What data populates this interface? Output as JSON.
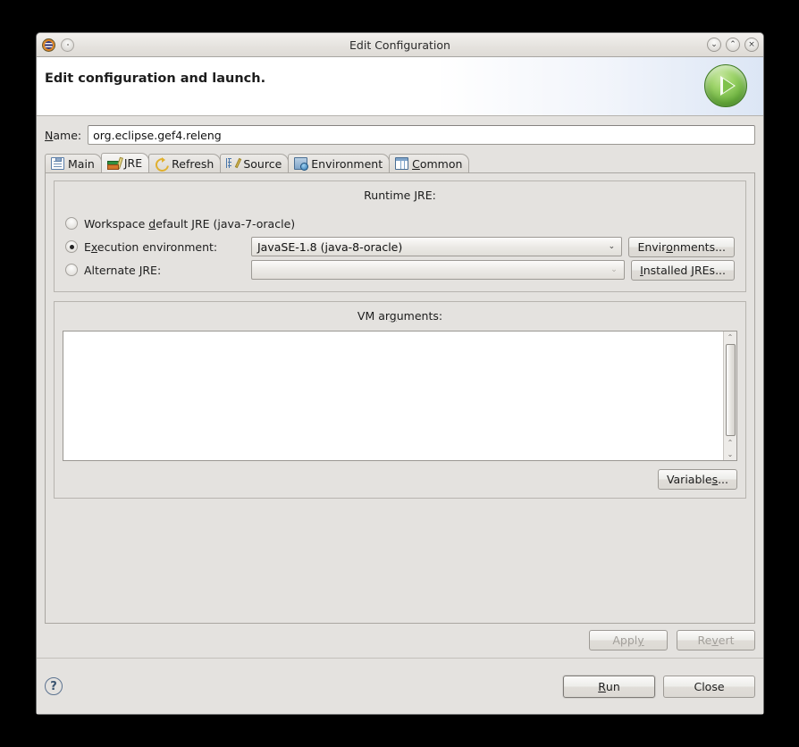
{
  "window": {
    "title": "Edit Configuration",
    "app_icon": "eclipse-icon",
    "menu_dot": "window-menu-icon",
    "controls": {
      "minimize": "⌄",
      "maximize": "⌃",
      "close": "×"
    }
  },
  "banner": {
    "title": "Edit configuration and launch.",
    "icon": "run-launch-icon"
  },
  "name_field": {
    "label": "Name:",
    "label_mnemonic": "N",
    "value": "org.eclipse.gef4.releng"
  },
  "tabs": [
    {
      "label": "Main",
      "icon": "main-document-icon",
      "active": false,
      "mnemonic": ""
    },
    {
      "label": "JRE",
      "icon": "jre-books-icon",
      "active": true,
      "mnemonic": ""
    },
    {
      "label": "Refresh",
      "icon": "refresh-arrows-icon",
      "active": false,
      "mnemonic": ""
    },
    {
      "label": "Source",
      "icon": "source-tree-icon",
      "active": false,
      "mnemonic": ""
    },
    {
      "label": "Environment",
      "icon": "environment-monitor-icon",
      "active": false,
      "mnemonic": ""
    },
    {
      "label": "Common",
      "icon": "common-table-icon",
      "active": false,
      "mnemonic": "C"
    }
  ],
  "runtime_jre": {
    "group_title": "Runtime JRE:",
    "options": [
      {
        "id": "workspace-default",
        "label_pre": "Workspace ",
        "label_mnemonic": "d",
        "label_post": "efault JRE (java-7-oracle)",
        "selected": false
      },
      {
        "id": "execution-environment",
        "label_pre": "E",
        "label_mnemonic": "x",
        "label_post": "ecution environment:",
        "selected": true,
        "combo_value": "JavaSE-1.8 (java-8-oracle)",
        "combo_disabled": false,
        "button_pre": "Envir",
        "button_mnemonic": "o",
        "button_post": "nments..."
      },
      {
        "id": "alternate-jre",
        "label_pre": "Alternate ",
        "label_mnemonic": "J",
        "label_post": "RE:",
        "selected": false,
        "combo_value": "",
        "combo_disabled": true,
        "button_pre": "",
        "button_mnemonic": "I",
        "button_post": "nstalled JREs..."
      }
    ],
    "combo_arrow": "⌄"
  },
  "vm_arguments": {
    "title_pre": "VM ar",
    "title_mnemonic": "g",
    "title_post": "uments:",
    "value": "",
    "variables_button": {
      "pre": "Variable",
      "mnemonic": "s",
      "post": "..."
    },
    "scrollbar": {
      "up": "⌃",
      "down": "⌄"
    }
  },
  "apply_revert": {
    "apply": {
      "pre": "Appl",
      "mnemonic": "y",
      "post": "",
      "disabled": true
    },
    "revert": {
      "pre": "Re",
      "mnemonic": "v",
      "post": "ert",
      "disabled": true
    }
  },
  "footer": {
    "help_icon": "?",
    "run": {
      "pre": "",
      "mnemonic": "R",
      "post": "un",
      "default": true
    },
    "close": {
      "pre": "Close",
      "mnemonic": "",
      "post": ""
    }
  }
}
